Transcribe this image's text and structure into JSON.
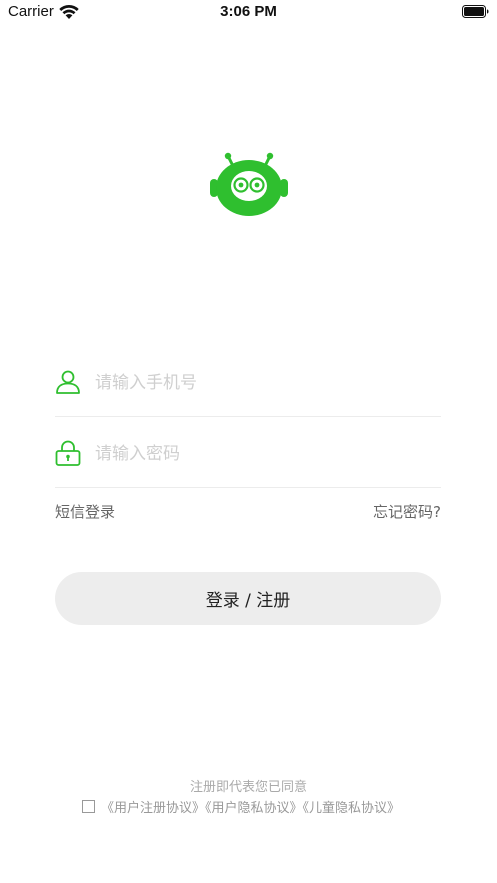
{
  "status_bar": {
    "carrier": "Carrier",
    "time": "3:06 PM"
  },
  "colors": {
    "brand_green": "#2fbf2f",
    "button_bg": "#ededed"
  },
  "login_form": {
    "phone_placeholder": "请输入手机号",
    "phone_icon": "user-outline-icon",
    "password_placeholder": "请输入密码",
    "password_icon": "lock-outline-icon",
    "sms_login_label": "短信登录",
    "forgot_password_label": "忘记密码?",
    "submit_label": "登录 / 注册"
  },
  "agreement": {
    "intro": "注册即代表您已同意",
    "checked": false,
    "links": [
      "《用户注册协议》",
      "《用户隐私协议》",
      "《儿童隐私协议》"
    ]
  }
}
